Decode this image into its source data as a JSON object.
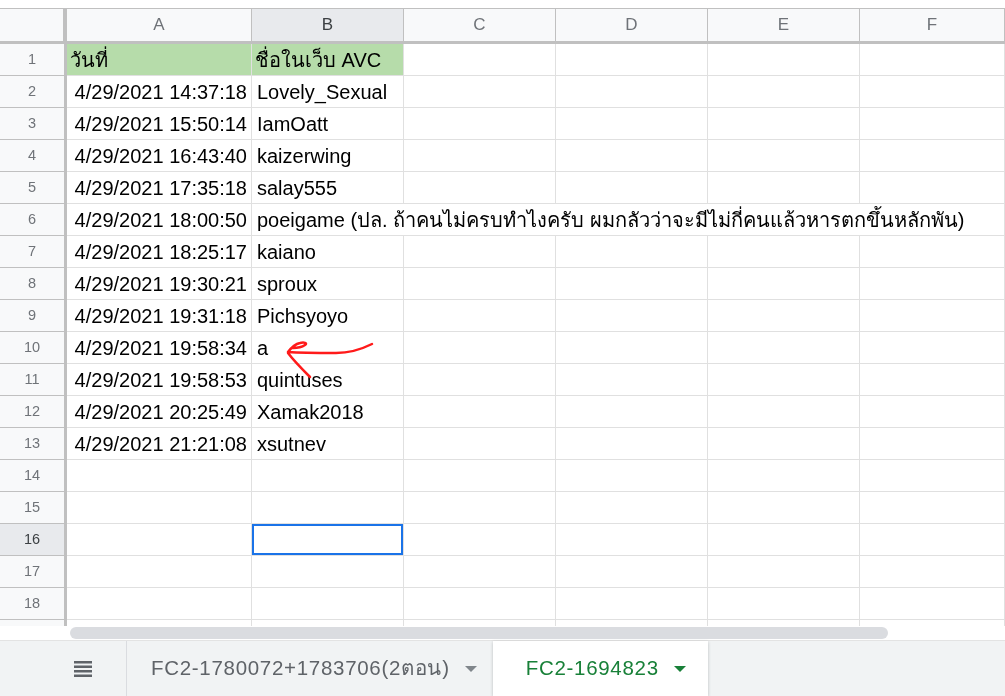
{
  "columns": [
    {
      "label": "A",
      "selected": false
    },
    {
      "label": "B",
      "selected": true
    },
    {
      "label": "C",
      "selected": false
    },
    {
      "label": "D",
      "selected": false
    },
    {
      "label": "E",
      "selected": false
    },
    {
      "label": "F",
      "selected": false
    }
  ],
  "rows": [
    {
      "number": "1",
      "kind": "header",
      "selected": false,
      "annotated": false,
      "cells": [
        "วันที่",
        "ชื่อในเว็บ AVC"
      ]
    },
    {
      "number": "2",
      "kind": "data",
      "selected": false,
      "annotated": false,
      "cells": [
        "4/29/2021 14:37:18",
        "Lovely_Sexual"
      ]
    },
    {
      "number": "3",
      "kind": "data",
      "selected": false,
      "annotated": false,
      "cells": [
        "4/29/2021 15:50:14",
        "IamOatt"
      ]
    },
    {
      "number": "4",
      "kind": "data",
      "selected": false,
      "annotated": false,
      "cells": [
        "4/29/2021 16:43:40",
        "kaizerwing"
      ]
    },
    {
      "number": "5",
      "kind": "data",
      "selected": false,
      "annotated": false,
      "cells": [
        "4/29/2021 17:35:18",
        "salay555"
      ]
    },
    {
      "number": "6",
      "kind": "data",
      "selected": false,
      "annotated": false,
      "cells": [
        "4/29/2021 18:00:50",
        "poeigame (ปล. ถ้าคนไม่ครบทำไงครับ ผมกลัวว่าจะมีไม่กี่คนแล้วหารตกขึ้นหลักพัน)"
      ]
    },
    {
      "number": "7",
      "kind": "data",
      "selected": false,
      "annotated": false,
      "cells": [
        "4/29/2021 18:25:17",
        "kaiano"
      ]
    },
    {
      "number": "8",
      "kind": "data",
      "selected": false,
      "annotated": false,
      "cells": [
        "4/29/2021 19:30:21",
        "sproux"
      ]
    },
    {
      "number": "9",
      "kind": "data",
      "selected": false,
      "annotated": false,
      "cells": [
        "4/29/2021 19:31:18",
        "Pichsyoyo"
      ]
    },
    {
      "number": "10",
      "kind": "data",
      "selected": false,
      "annotated": true,
      "cells": [
        "4/29/2021 19:58:34",
        "a"
      ]
    },
    {
      "number": "11",
      "kind": "data",
      "selected": false,
      "annotated": false,
      "cells": [
        "4/29/2021 19:58:53",
        "quintuses"
      ]
    },
    {
      "number": "12",
      "kind": "data",
      "selected": false,
      "annotated": false,
      "cells": [
        "4/29/2021 20:25:49",
        "Xamak2018"
      ]
    },
    {
      "number": "13",
      "kind": "data",
      "selected": false,
      "annotated": false,
      "cells": [
        "4/29/2021 21:21:08",
        "xsutnev"
      ]
    },
    {
      "number": "14",
      "kind": "data",
      "selected": false,
      "annotated": false
    },
    {
      "number": "15",
      "kind": "data",
      "selected": false,
      "annotated": false
    },
    {
      "number": "16",
      "kind": "data",
      "selected": true,
      "annotated": false
    },
    {
      "number": "17",
      "kind": "data",
      "selected": false,
      "annotated": false
    },
    {
      "number": "18",
      "kind": "data",
      "selected": false,
      "annotated": false
    }
  ],
  "sheet_tabs": [
    {
      "label": "FC2-1780072+1783706(2ตอน)",
      "selected": false
    },
    {
      "label": "FC2-1694823",
      "selected": true
    }
  ]
}
